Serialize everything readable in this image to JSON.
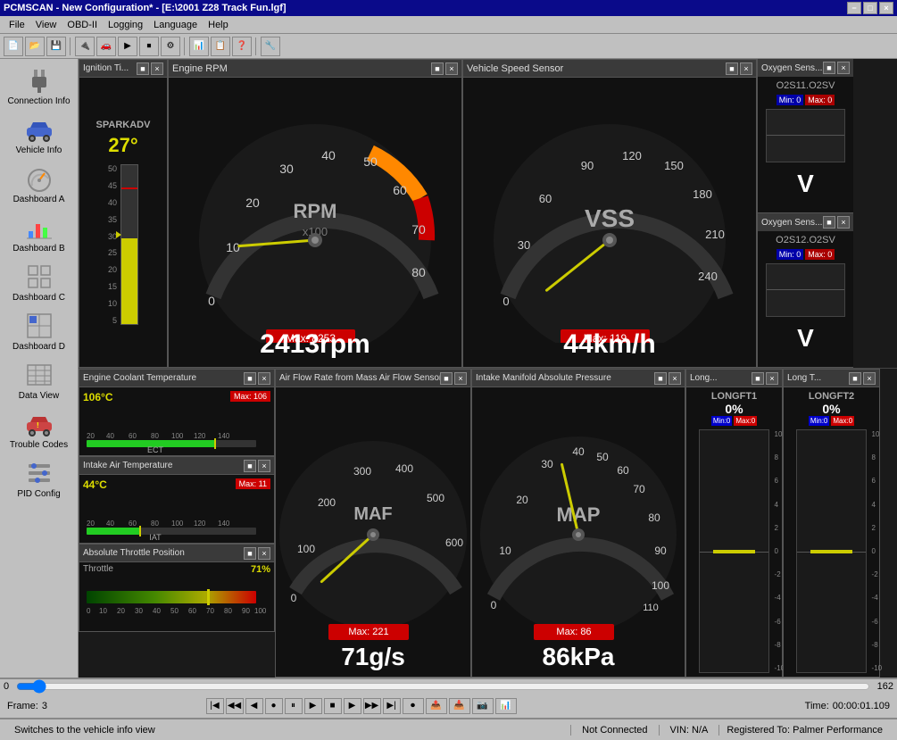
{
  "window": {
    "title": "PCMSCAN - New Configuration* - [E:\\2001 Z28 Track Fun.lgf]",
    "controls": [
      "-",
      "□",
      "×"
    ]
  },
  "menu": {
    "items": [
      "File",
      "View",
      "OBD-II",
      "Logging",
      "Language",
      "Help"
    ]
  },
  "sidebar": {
    "items": [
      {
        "id": "connection-info",
        "label": "Connection Info",
        "icon": "plug"
      },
      {
        "id": "vehicle-info",
        "label": "Vehicle Info",
        "icon": "car"
      },
      {
        "id": "dashboard-a",
        "label": "Dashboard A",
        "icon": "gauge"
      },
      {
        "id": "dashboard-b",
        "label": "Dashboard B",
        "icon": "chart"
      },
      {
        "id": "dashboard-c",
        "label": "Dashboard C",
        "icon": "grid"
      },
      {
        "id": "dashboard-d",
        "label": "Dashboard D",
        "icon": "grid2"
      },
      {
        "id": "data-view",
        "label": "Data View",
        "icon": "table"
      },
      {
        "id": "trouble-codes",
        "label": "Trouble Codes",
        "icon": "car2"
      },
      {
        "id": "pid-config",
        "label": "PID Config",
        "icon": "config"
      }
    ]
  },
  "panels": {
    "ignition": {
      "title": "Ignition Ti...",
      "value": "27°",
      "label": "SPARKADV"
    },
    "rpm": {
      "title": "Engine RPM",
      "value": "2413rpm",
      "max_label": "Max: 8253",
      "gauge_label": "RPM",
      "multiplier": "x100",
      "needle_angle": 155
    },
    "vss": {
      "title": "Vehicle Speed Sensor",
      "value": "44km/h",
      "max_label": "Max: 119",
      "gauge_label": "VSS",
      "needle_angle": 140
    },
    "o2s11": {
      "title": "Oxygen Sens...",
      "subtitle": "O2S11.O2SV",
      "value": "V",
      "min_label": "Min: 0",
      "max_label": "Max: 0"
    },
    "o2s12": {
      "title": "Oxygen Sens...",
      "subtitle": "O2S12.O2SV",
      "value": "V",
      "min_label": "Min: 0",
      "max_label": "Max: 0"
    },
    "ect": {
      "title": "Engine Coolant Temperature",
      "value": "106°C",
      "max_label": "Max: 106",
      "label": "ECT"
    },
    "maf": {
      "title": "Air Flow Rate from Mass Air Flow Sensor",
      "value": "71g/s",
      "max_label": "Max: 221",
      "gauge_label": "MAF",
      "needle_angle": 200
    },
    "map": {
      "title": "Intake Manifold Absolute Pressure",
      "value": "86kPa",
      "max_label": "Max: 86",
      "gauge_label": "MAP",
      "needle_angle": 185
    },
    "iat": {
      "title": "Intake Air Temperature",
      "value": "44°C",
      "max_label": "Max: 11",
      "label": "IAT"
    },
    "throttle": {
      "title": "Absolute Throttle Position",
      "value": "71%",
      "label": "Throttle"
    },
    "longft1": {
      "title": "Long...",
      "label": "LONGFT1",
      "value": "0%",
      "min": "0",
      "max": "0"
    },
    "longft2": {
      "title": "Long T...",
      "label": "LONGFT2",
      "value": "0%",
      "min": "0",
      "max": "0"
    }
  },
  "playback": {
    "frame_label": "Frame:",
    "frame_value": "3",
    "slider_min": "0",
    "slider_max": "162",
    "time_label": "Time:",
    "time_value": "00:00:01.109"
  },
  "statusbar": {
    "hint": "Switches to the vehicle info view",
    "connection": "Not Connected",
    "vin": "VIN: N/A",
    "registered": "Registered To: Palmer Performance"
  }
}
